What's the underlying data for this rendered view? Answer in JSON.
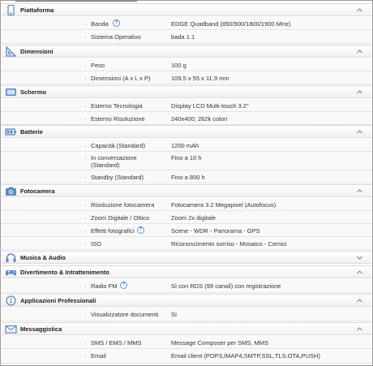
{
  "colors": {
    "icon": "#5a86c0",
    "chevron": "#6a8fc4",
    "help": "#3b6fb6"
  },
  "sections": [
    {
      "title": "Piattaforma",
      "icon": "smartphone-icon",
      "rows": [
        {
          "label": "Banda",
          "value": "EDGE Quadband (850/900/1800/1900 MHz)",
          "help": "?"
        },
        {
          "label": "Sistema Operativo",
          "value": "bada 1.1"
        }
      ]
    },
    {
      "title": "Dimensioni",
      "icon": "ruler-triangle-icon",
      "rows": [
        {
          "label": "Peso",
          "value": "100 g"
        },
        {
          "label": "Dimensioni (A x L x P)",
          "value": "109.5 x 55 x 11.9 mm"
        }
      ]
    },
    {
      "title": "Schermo",
      "icon": "screen-icon",
      "rows": [
        {
          "label": "Esterno Tecnologia",
          "value": "Display LCD Multi-touch 3.2\""
        },
        {
          "label": "Esterno Risoluzione",
          "value": "240x400; 262k colori"
        }
      ]
    },
    {
      "title": "Batterie",
      "icon": "battery-icon",
      "rows": [
        {
          "label": "Capacità (Standard)",
          "value": "1200 mAh"
        },
        {
          "label": "In conversazione",
          "label2": "(Standard)",
          "value": "Fino a 10 h"
        },
        {
          "label": "Standby (Standard)",
          "value": "Fino a 800 h"
        }
      ]
    },
    {
      "title": "Fotocamera",
      "icon": "camera-icon",
      "rows": [
        {
          "label": "Risoluzione fotocamera",
          "value": "Fotocamera 3.2 Megapixel (Autofocus)"
        },
        {
          "label": "Zoom Digitale / Ottico",
          "value": "Zoom 2x digitale"
        },
        {
          "label": "Effetti fotografici",
          "value": "Scene - WDR - Panorama - GPS",
          "help": "?"
        },
        {
          "label": "ISO",
          "value": "Riconoscimento sorriso - Mosaico - Cornici"
        }
      ]
    },
    {
      "title": "Musica & Audio",
      "icon": "headphones-icon",
      "rows": []
    },
    {
      "title": "Divertimento & Intrattenimento",
      "icon": "gamepad-icon",
      "rows": [
        {
          "label": "Radio FM",
          "value": "Sì con RDS (99 canali) con registrazione",
          "help": "?"
        }
      ]
    },
    {
      "title": "Applicazioni Professionali",
      "icon": "info-icon",
      "rows": [
        {
          "label": "Visualizzatore documenti",
          "value": "Sì"
        }
      ]
    },
    {
      "title": "Messaggistica",
      "icon": "envelope-icon",
      "rows": [
        {
          "label": "SMS / EMS / MMS",
          "value": "Message Composer per SMS, MMS"
        },
        {
          "label": "Email",
          "value": "Email client (POP3,IMAP4,SMTP,SSL,TLS,OTA,PUSH)"
        }
      ]
    }
  ]
}
